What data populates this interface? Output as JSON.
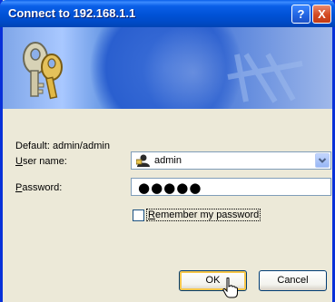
{
  "window": {
    "title": "Connect to 192.168.1.1",
    "help_button": "?",
    "close_button": "X"
  },
  "form": {
    "default_hint": "Default: admin/admin",
    "username_label_accel": "U",
    "username_label_rest": "ser name:",
    "username_value": "admin",
    "password_label_accel": "P",
    "password_label_rest": "assword:",
    "password_masked": "●●●●●",
    "remember_accel": "R",
    "remember_rest": "emember my password",
    "remember_checked": false
  },
  "buttons": {
    "ok": "OK",
    "cancel": "Cancel"
  },
  "colors": {
    "title_bar": "#0052d6",
    "dialog_bg": "#ece9d8",
    "close_button": "#d44a22"
  },
  "icons": [
    "keys-icon",
    "user-icon",
    "chevron-down-icon",
    "cursor-icon"
  ]
}
